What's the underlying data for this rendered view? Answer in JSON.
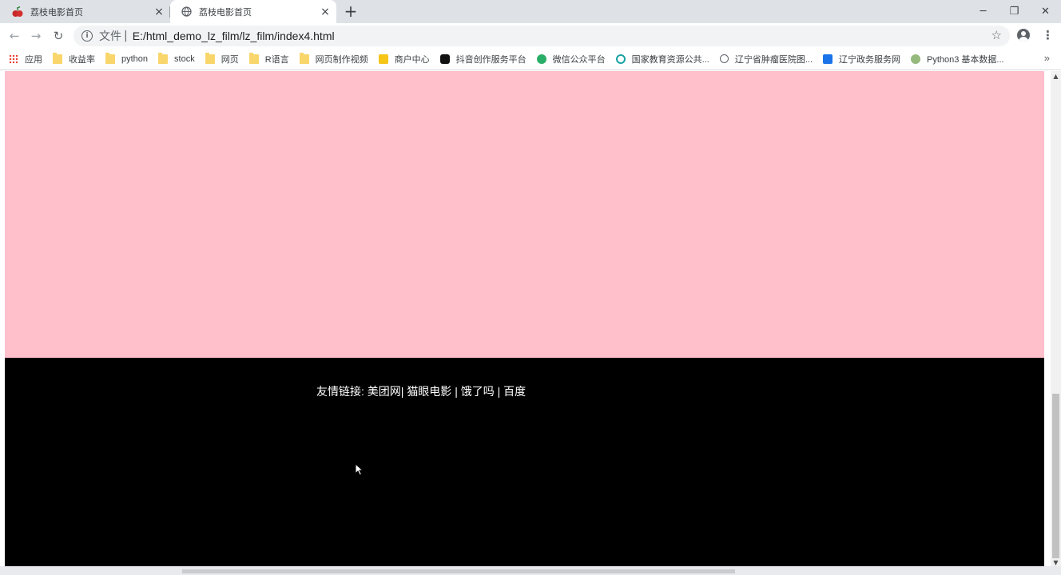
{
  "browser": {
    "tabs": [
      {
        "title": "荔枝电影首页",
        "active": false,
        "close": "×"
      },
      {
        "title": "荔枝电影首页",
        "active": true,
        "close": "×"
      }
    ],
    "new_tab": "+",
    "window_controls": {
      "minimize": "─",
      "restore": "❐",
      "close": "✕"
    }
  },
  "toolbar": {
    "back": "←",
    "forward": "→",
    "reload": "↻",
    "info_glyph": "i",
    "scheme_label": "文件",
    "separator": "|",
    "url": "E:/html_demo_lz_film/lz_film/index4.html",
    "star": "☆",
    "menu": "⋮"
  },
  "bookmarks": {
    "items": [
      {
        "label": "应用",
        "icon": "apps-icon"
      },
      {
        "label": "收益率",
        "icon": "folder-icon"
      },
      {
        "label": "python",
        "icon": "folder-icon"
      },
      {
        "label": "stock",
        "icon": "folder-icon"
      },
      {
        "label": "网页",
        "icon": "folder-icon"
      },
      {
        "label": "R语言",
        "icon": "folder-icon"
      },
      {
        "label": "网页制作视频",
        "icon": "folder-icon"
      },
      {
        "label": "商户中心",
        "icon": "merchant-icon"
      },
      {
        "label": "抖音创作服务平台",
        "icon": "douyin-icon"
      },
      {
        "label": "微信公众平台",
        "icon": "wechat-icon"
      },
      {
        "label": "国家教育资源公共...",
        "icon": "edu-icon"
      },
      {
        "label": "辽宁省肿瘤医院图...",
        "icon": "globe-icon"
      },
      {
        "label": "辽宁政务服务网",
        "icon": "gov-icon"
      },
      {
        "label": "Python3 基本数据...",
        "icon": "runoob-icon"
      }
    ],
    "more": "»"
  },
  "page": {
    "footer": {
      "prefix": "友情链接: ",
      "links": [
        "美团网",
        "猫眼电影",
        "饿了吗",
        "百度"
      ],
      "separators": [
        "| ",
        " | ",
        " | "
      ]
    }
  },
  "colors": {
    "pink_section": "#ffc0cb",
    "footer_bg": "#000000",
    "footer_text": "#ffffff"
  }
}
